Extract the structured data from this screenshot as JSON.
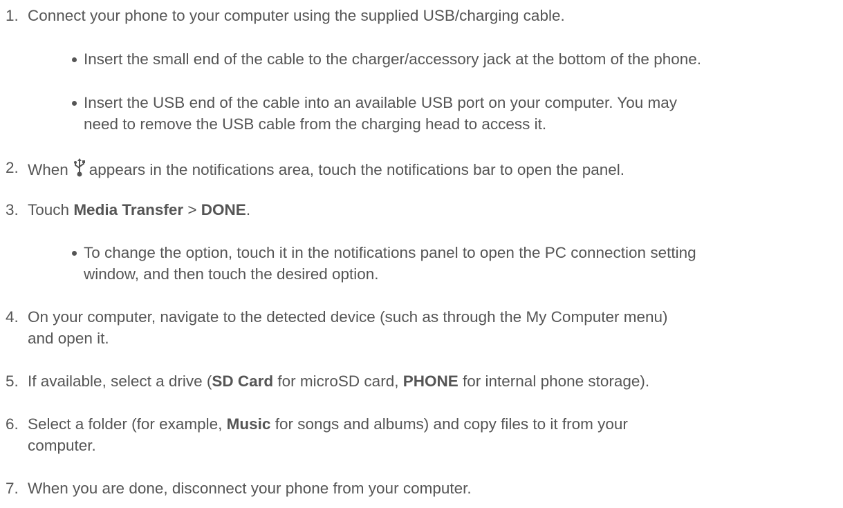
{
  "steps": [
    {
      "number": "1.",
      "text": "Connect your phone to your computer using the supplied USB/charging cable.",
      "bullets": [
        {
          "lines": [
            "Insert the small end of the cable to the charger/accessory jack at the bottom of the phone."
          ]
        },
        {
          "lines": [
            "Insert the USB end of the cable into an available USB port on your computer. You may",
            "need to remove the USB cable from the charging head to access it."
          ]
        }
      ]
    },
    {
      "number": "2.",
      "text_before_icon": "When",
      "icon": "usb-icon",
      "text_after_icon": "appears in the notifications area, touch the notifications bar to open the panel."
    },
    {
      "number": "3.",
      "prefix": "Touch",
      "bold1": "Media Transfer",
      "sep": ">",
      "bold2": "DONE",
      "suffix": ".",
      "bullets": [
        {
          "lines": [
            "To change the option, touch it in the notifications panel to open the PC connection setting",
            "window, and then touch the desired option."
          ]
        }
      ]
    },
    {
      "number": "4.",
      "lines": [
        "On your computer, navigate to the detected device (such as through the My Computer menu)",
        "and open it."
      ]
    },
    {
      "number": "5.",
      "part1": "If available, select a drive (",
      "bold1": "SD Card",
      "part2": "for microSD card,",
      "bold2": "PHONE",
      "part3": "for internal phone storage)."
    },
    {
      "number": "6.",
      "part1": "Select a folder (for example,",
      "bold1": "Music",
      "part2": "for songs and albums) and copy files to it from your",
      "line2": "computer."
    },
    {
      "number": "7.",
      "text": "When you are done, disconnect your phone from your computer."
    }
  ]
}
